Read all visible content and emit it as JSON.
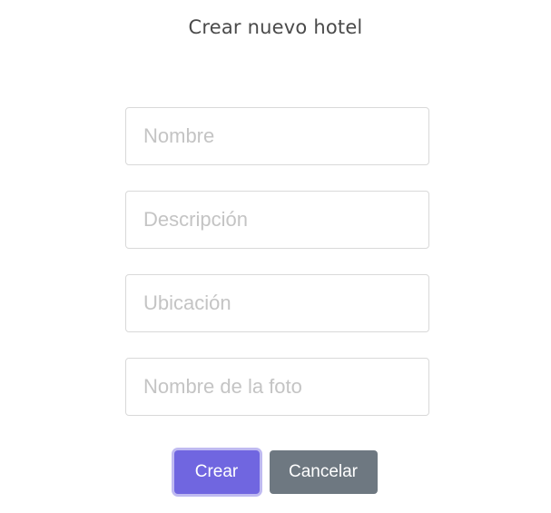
{
  "dialog": {
    "title": "Crear nuevo hotel"
  },
  "form": {
    "nombre": {
      "placeholder": "Nombre",
      "value": ""
    },
    "descripcion": {
      "placeholder": "Descripción",
      "value": ""
    },
    "ubicacion": {
      "placeholder": "Ubicación",
      "value": ""
    },
    "foto": {
      "placeholder": "Nombre de la foto",
      "value": ""
    }
  },
  "actions": {
    "confirm_label": "Crear",
    "cancel_label": "Cancelar"
  },
  "colors": {
    "confirm_button": "#7066e0",
    "cancel_button": "#6e7881",
    "title_text": "#4a4a4a"
  }
}
